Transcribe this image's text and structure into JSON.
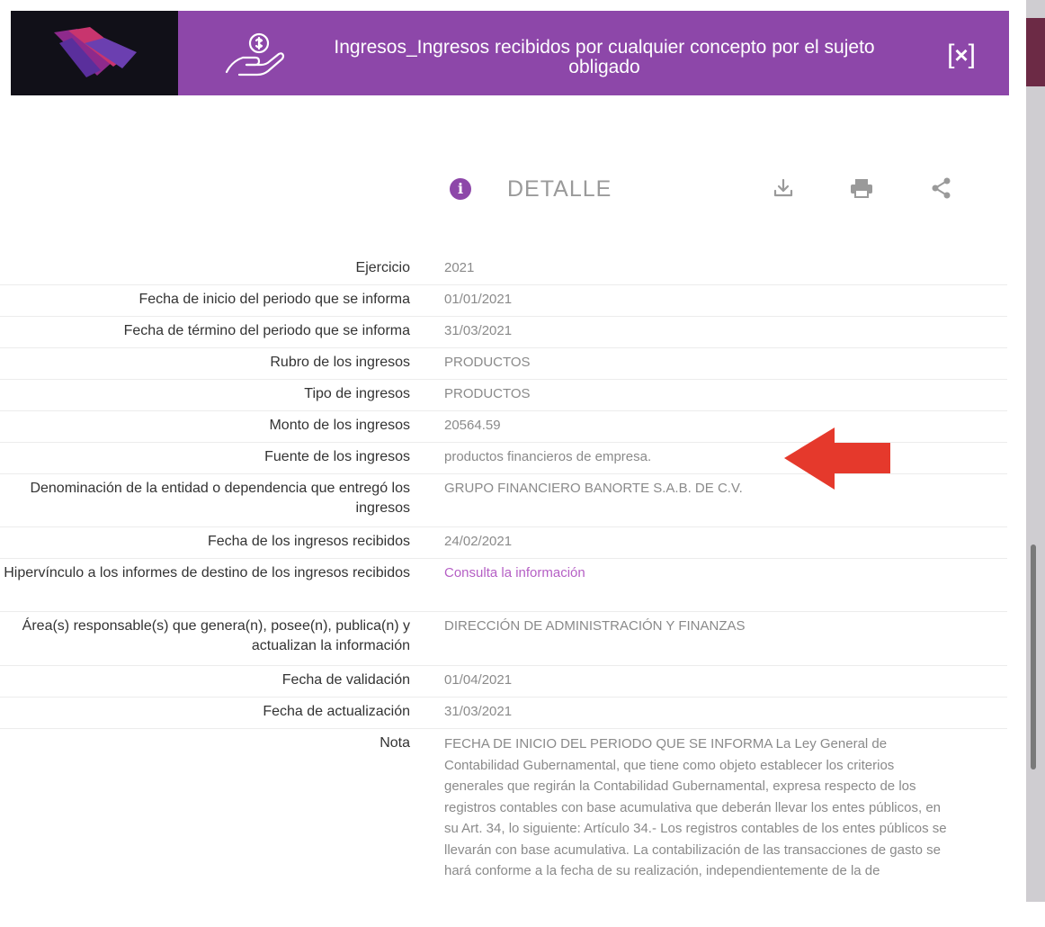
{
  "header": {
    "title": "Ingresos_Ingresos recibidos por cualquier concepto por el sujeto obligado",
    "close_label": "×",
    "close_bracket_left": "[",
    "close_bracket_right": "]"
  },
  "detail": {
    "heading": "DETALLE",
    "info_icon": "i"
  },
  "toolbar": {
    "download_icon": "download-icon",
    "print_icon": "print-icon",
    "share_icon": "share-icon"
  },
  "fields": [
    {
      "label": "Ejercicio",
      "value": "2021"
    },
    {
      "label": "Fecha de inicio del periodo que se informa",
      "value": "01/01/2021"
    },
    {
      "label": "Fecha de término del periodo que se informa",
      "value": "31/03/2021"
    },
    {
      "label": "Rubro de los ingresos",
      "value": "PRODUCTOS"
    },
    {
      "label": "Tipo de ingresos",
      "value": "PRODUCTOS"
    },
    {
      "label": "Monto de los ingresos",
      "value": "20564.59"
    },
    {
      "label": "Fuente de los ingresos",
      "value": "productos financieros de empresa."
    },
    {
      "label": "Denominación de la entidad o dependencia que entregó los ingresos",
      "value": "GRUPO FINANCIERO BANORTE S.A.B. DE C.V."
    },
    {
      "label": "Fecha de los ingresos recibidos",
      "value": "24/02/2021"
    },
    {
      "label": "Hipervínculo a los informes de destino de los ingresos recibidos",
      "value": "Consulta la información"
    },
    {
      "label": "Área(s) responsable(s) que genera(n), posee(n), publica(n) y actualizan la información",
      "value": "DIRECCIÓN DE ADMINISTRACIÓN Y FINANZAS"
    },
    {
      "label": "Fecha de validación",
      "value": "01/04/2021"
    },
    {
      "label": "Fecha de actualización",
      "value": "31/03/2021"
    },
    {
      "label": "Nota",
      "value": "FECHA DE INICIO DEL PERIODO QUE SE INFORMA La Ley General de Contabilidad Gubernamental, que tiene como objeto establecer los criterios generales que regirán la Contabilidad Gubernamental, expresa respecto de los registros contables con base acumulativa que deberán llevar los entes públicos, en su Art. 34, lo siguiente: Artículo 34.- Los registros contables de los entes públicos se llevarán con base acumulativa. La contabilización de las transacciones de gasto se hará conforme a la fecha de su realización, independientemente de la de"
    }
  ],
  "colors": {
    "header_bg": "#8d47a9",
    "logo_bg": "#111018",
    "link": "#b55fc5",
    "arrow": "#e5392c"
  }
}
